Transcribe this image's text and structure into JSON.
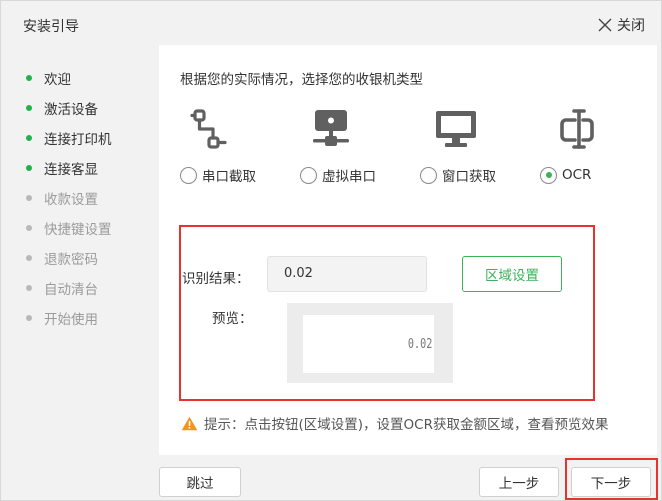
{
  "window": {
    "title": "安装引导",
    "close_label": "关闭"
  },
  "sidebar": {
    "items": [
      {
        "label": "欢迎",
        "status": "done"
      },
      {
        "label": "激活设备",
        "status": "done"
      },
      {
        "label": "连接打印机",
        "status": "done"
      },
      {
        "label": "连接客显",
        "status": "done"
      },
      {
        "label": "收款设置",
        "status": "pending"
      },
      {
        "label": "快捷键设置",
        "status": "pending"
      },
      {
        "label": "退款密码",
        "status": "pending"
      },
      {
        "label": "自动清台",
        "status": "pending"
      },
      {
        "label": "开始使用",
        "status": "pending"
      }
    ]
  },
  "main": {
    "instruction": "根据您的实际情况，选择您的收银机类型",
    "types": [
      {
        "label": "串口截取",
        "icon": "serial-cable-icon",
        "selected": false
      },
      {
        "label": "虚拟串口",
        "icon": "network-icon",
        "selected": false
      },
      {
        "label": "窗口获取",
        "icon": "monitor-icon",
        "selected": false
      },
      {
        "label": "OCR",
        "icon": "ocr-icon",
        "selected": true
      }
    ],
    "ocr": {
      "result_label": "识别结果：",
      "result_value": "0.02",
      "area_button": "区域设置",
      "preview_label": "预览：",
      "preview_value": "0.02"
    },
    "tip": "提示：点击按钮(区域设置)，设置OCR获取金额区域，查看预览效果"
  },
  "footer": {
    "skip": "跳过",
    "prev": "上一步",
    "next": "下一步"
  },
  "colors": {
    "accent": "#3bb15a",
    "highlight": "#e8322e",
    "icon": "#606060",
    "warning": "#f0961e"
  }
}
